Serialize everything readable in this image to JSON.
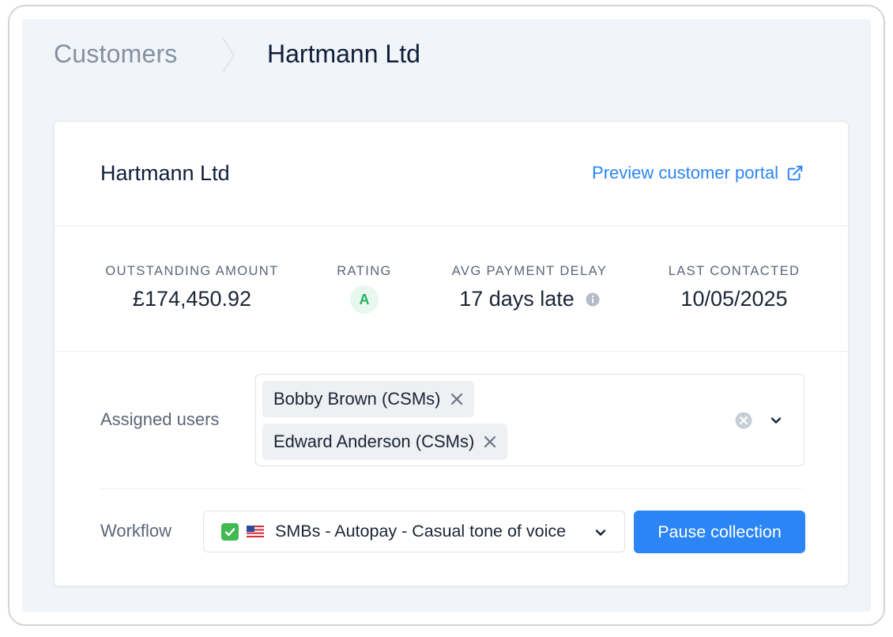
{
  "breadcrumb": {
    "parent": "Customers",
    "current": "Hartmann Ltd"
  },
  "customer": {
    "name": "Hartmann Ltd",
    "portal_link": "Preview customer portal"
  },
  "stats": {
    "outstanding": {
      "label": "OUTSTANDING AMOUNT",
      "value": "£174,450.92"
    },
    "rating": {
      "label": "RATING",
      "value": "A"
    },
    "delay": {
      "label": "AVG PAYMENT DELAY",
      "value": "17 days late"
    },
    "last_contacted": {
      "label": "LAST CONTACTED",
      "value": "10/05/2025"
    }
  },
  "assigned_users": {
    "label": "Assigned users",
    "users": [
      "Bobby Brown (CSMs)",
      "Edward Anderson (CSMs)"
    ]
  },
  "workflow": {
    "label": "Workflow",
    "selected": "SMBs - Autopay - Casual tone of voice",
    "pause_label": "Pause collection"
  },
  "colors": {
    "accent": "#2b85f5",
    "rating_green": "#22b45a",
    "background": "#f1f4f8"
  },
  "icons": [
    "chevron-right-icon",
    "external-link-icon",
    "info-icon",
    "close-icon",
    "clear-icon",
    "chevron-down-icon",
    "check-mark-emoji",
    "us-flag-emoji"
  ]
}
